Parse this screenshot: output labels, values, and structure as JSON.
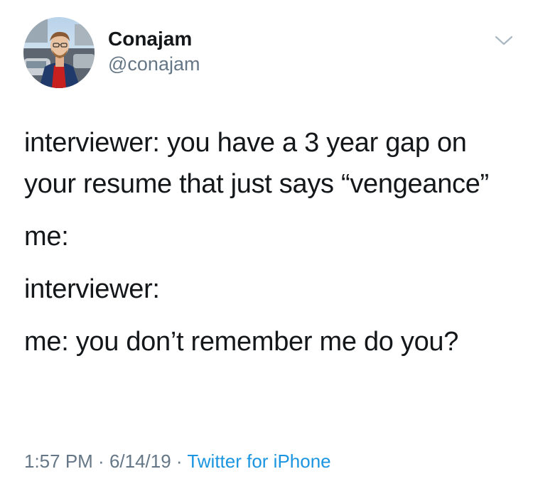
{
  "tweet": {
    "author": {
      "name": "Conajam",
      "handle": "@conajam"
    },
    "body": [
      "interviewer: you have a 3 year gap on your resume that just says “vengeance”",
      "me:",
      "interviewer:",
      "me: you don’t remember me do you?"
    ],
    "time": "1:57 PM",
    "separator1": " · ",
    "date": "6/14/19",
    "separator2": " · ",
    "source": "Twitter for iPhone"
  },
  "icons": {
    "menu": "chevron-down-icon"
  },
  "colors": {
    "text": "#14171a",
    "secondary": "#657786",
    "link": "#1b95e0"
  }
}
